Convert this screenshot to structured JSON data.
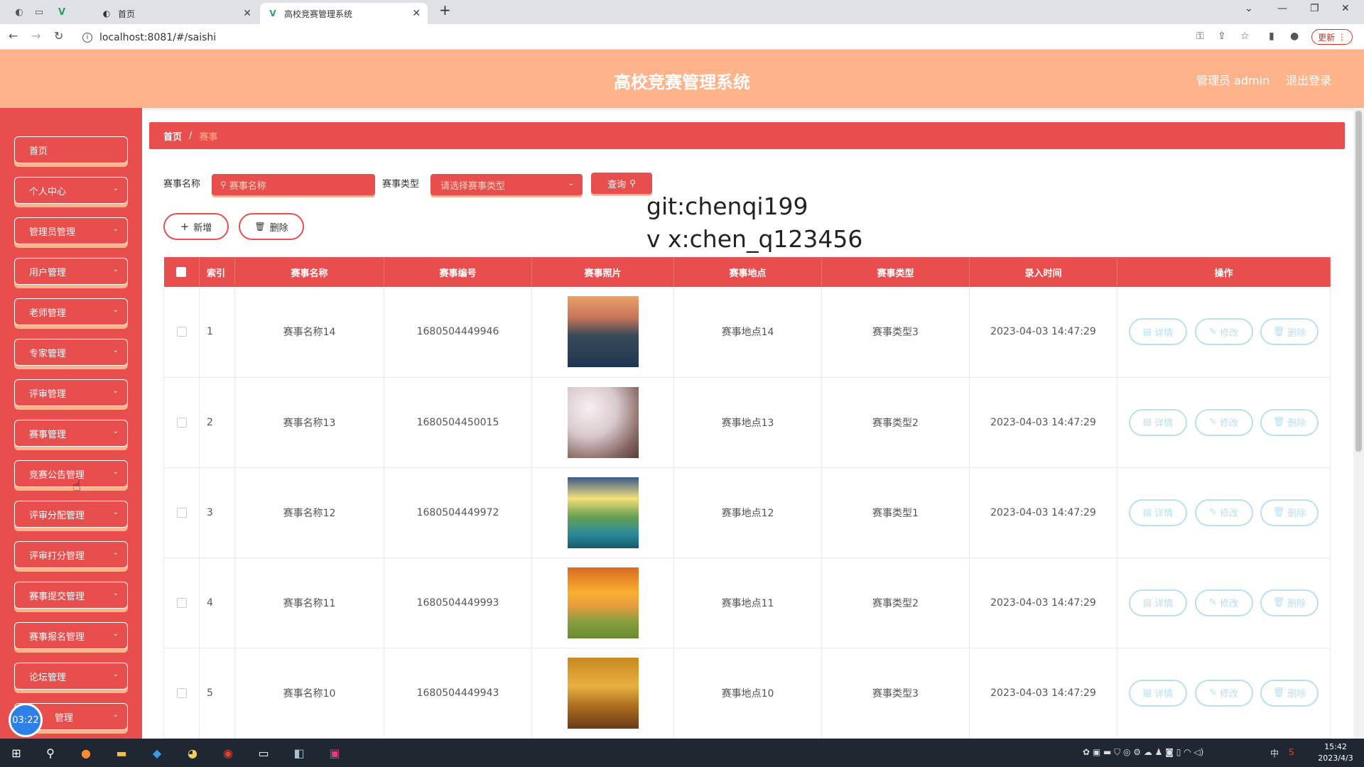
{
  "browser": {
    "tabs": [
      {
        "label": "首页"
      },
      {
        "label": "高校竞赛管理系统"
      }
    ],
    "url": "localhost:8081/#/saishi",
    "update_label": "更新"
  },
  "header": {
    "title": "高校竞赛管理系统",
    "user": "管理员 admin",
    "logout": "退出登录"
  },
  "sidebar": {
    "items": [
      {
        "label": "首页"
      },
      {
        "label": "个人中心"
      },
      {
        "label": "管理员管理"
      },
      {
        "label": "用户管理"
      },
      {
        "label": "老师管理"
      },
      {
        "label": "专家管理"
      },
      {
        "label": "评审管理"
      },
      {
        "label": "赛事管理"
      },
      {
        "label": "竞赛公告管理"
      },
      {
        "label": "评审分配管理"
      },
      {
        "label": "评审打分管理"
      },
      {
        "label": "赛事提交管理"
      },
      {
        "label": "赛事报名管理"
      },
      {
        "label": "论坛管理"
      },
      {
        "label": "管理"
      }
    ],
    "timer": "03:22"
  },
  "breadcrumb": {
    "home": "首页",
    "separator": "/",
    "current": "赛事"
  },
  "search": {
    "name_label": "赛事名称",
    "name_placeholder": "赛事名称",
    "type_label": "赛事类型",
    "type_placeholder": "请选择赛事类型",
    "query_label": "查询"
  },
  "actions": {
    "add_label": "新增",
    "delete_label": "删除"
  },
  "watermark": {
    "line1": "git:chenqi199",
    "line2": "v x:chen_q123456"
  },
  "table": {
    "headers": [
      "索引",
      "赛事名称",
      "赛事编号",
      "赛事照片",
      "赛事地点",
      "赛事类型",
      "录入时间",
      "操作"
    ],
    "row_buttons": {
      "detail": "详情",
      "edit": "修改",
      "delete": "删除"
    },
    "rows": [
      {
        "index": "1",
        "name": "赛事名称14",
        "code": "1680504449946",
        "location": "赛事地点14",
        "type": "赛事类型3",
        "time": "2023-04-03 14:47:29"
      },
      {
        "index": "2",
        "name": "赛事名称13",
        "code": "1680504450015",
        "location": "赛事地点13",
        "type": "赛事类型2",
        "time": "2023-04-03 14:47:29"
      },
      {
        "index": "3",
        "name": "赛事名称12",
        "code": "1680504449972",
        "location": "赛事地点12",
        "type": "赛事类型1",
        "time": "2023-04-03 14:47:29"
      },
      {
        "index": "4",
        "name": "赛事名称11",
        "code": "1680504449993",
        "location": "赛事地点11",
        "type": "赛事类型2",
        "time": "2023-04-03 14:47:29"
      },
      {
        "index": "5",
        "name": "赛事名称10",
        "code": "1680504449943",
        "location": "赛事地点10",
        "type": "赛事类型3",
        "time": "2023-04-03 14:47:29"
      }
    ]
  },
  "taskbar": {
    "time": "15:42",
    "date": "2023/4/3",
    "ime": "中"
  },
  "colors": {
    "primary": "#e84e4e",
    "header": "#ffb38a",
    "action_button": "#b8e0ee"
  }
}
